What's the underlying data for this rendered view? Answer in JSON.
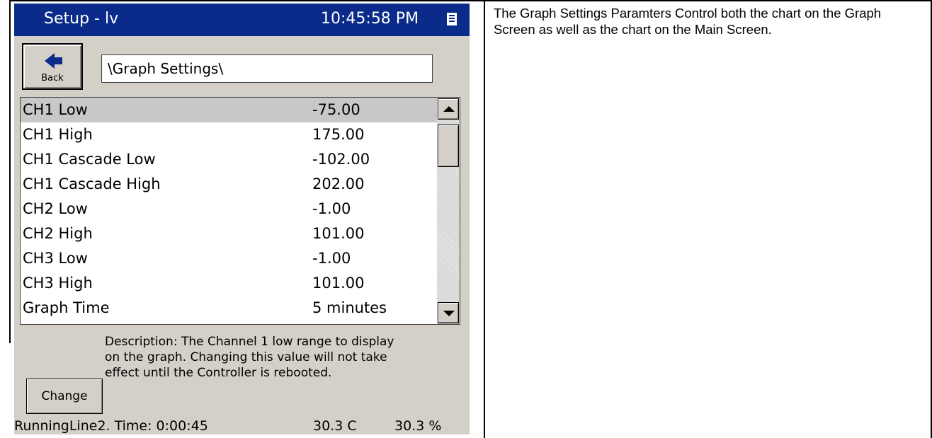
{
  "device": {
    "title": "Setup - lv",
    "clock": "10:45:58 PM",
    "back_label": "Back",
    "path": "\\Graph Settings\\",
    "settings": [
      {
        "name": "CH1 Low",
        "value": "-75.00",
        "selected": true
      },
      {
        "name": "CH1 High",
        "value": "175.00"
      },
      {
        "name": "CH1 Cascade Low",
        "value": "-102.00"
      },
      {
        "name": "CH1 Cascade High",
        "value": "202.00"
      },
      {
        "name": "CH2 Low",
        "value": "-1.00"
      },
      {
        "name": "CH2 High",
        "value": "101.00"
      },
      {
        "name": "CH3 Low",
        "value": "-1.00"
      },
      {
        "name": "CH3 High",
        "value": "101.00"
      },
      {
        "name": "Graph Time",
        "value": "5 minutes"
      }
    ],
    "description_lines": [
      "Description:  The Channel 1 low range to display",
      "on the graph.  Changing this value will not take",
      "effect until the Controller is rebooted."
    ],
    "change_label": "Change",
    "status": {
      "running": "RunningLine2.  Time: 0:00:45",
      "temperature": "30.3 C",
      "humidity": "30.3 %"
    }
  },
  "document": {
    "text": "The Graph Settings Paramters Control both the chart on the Graph Screen as well as the chart on the Main Screen."
  },
  "colors": {
    "title_bar": "#0a2b8a",
    "panel": "#d4d0c8",
    "selection": "#c8c8c8"
  }
}
